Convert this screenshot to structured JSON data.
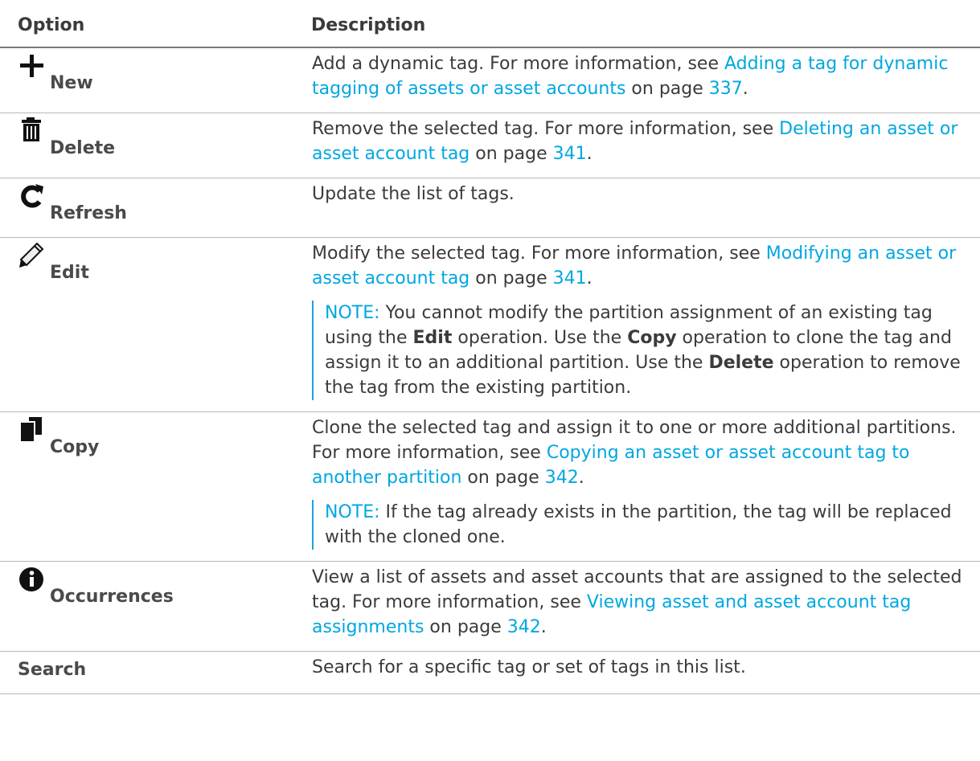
{
  "header": {
    "option": "Option",
    "description": "Description"
  },
  "rows": [
    {
      "label": "New",
      "icon": "plus-icon",
      "d1": "Add a dynamic tag. For more information, see ",
      "link": "Adding a tag for dynamic tagging of assets or asset accounts",
      "d2": " on page ",
      "page": "337",
      "d3": "."
    },
    {
      "label": "Delete",
      "icon": "trash-icon",
      "d1": "Remove the selected tag. For more information, see ",
      "link": "Deleting an asset or asset account tag",
      "d2": " on page ",
      "page": "341",
      "d3": "."
    },
    {
      "label": "Refresh",
      "icon": "refresh-icon",
      "d1": "Update the list of tags."
    },
    {
      "label": "Edit",
      "icon": "pencil-icon",
      "d1": "Modify the selected tag. For more information, see ",
      "link": "Modifying an asset or asset account tag",
      "d2": " on page ",
      "page": "341",
      "d3": ".",
      "note": {
        "lead": "NOTE:",
        "t1": " You cannot modify the partition assignment of an existing tag using the ",
        "b1": "Edit",
        "t2": " operation. Use the ",
        "b2": "Copy",
        "t3": " operation to clone the tag and assign it to an additional partition. Use the ",
        "b3": "Delete",
        "t4": " operation to remove the tag from the existing partition."
      }
    },
    {
      "label": "Copy",
      "icon": "copy-icon",
      "d1": "Clone the selected tag and assign it to one or more additional partitions. For more information, see ",
      "link": "Copying an asset or asset account tag to another partition",
      "d2": " on page ",
      "page": "342",
      "d3": ".",
      "note": {
        "lead": "NOTE:",
        "t1": " If the tag already exists in the partition, the tag will be replaced with the cloned one."
      }
    },
    {
      "label": "Occurrences",
      "icon": "info-icon",
      "d1": "View a list of assets and asset accounts that are assigned to the selected tag. For more information, see ",
      "link": "Viewing asset and asset account tag assignments",
      "d2": " on page ",
      "page": "342",
      "d3": "."
    },
    {
      "label": "Search",
      "d1": "Search for a specific tag or set of tags in this list."
    }
  ],
  "colors": {
    "link": "#00a7e0",
    "text": "#3b3b3b",
    "note_bar": "#1aa4dd"
  }
}
